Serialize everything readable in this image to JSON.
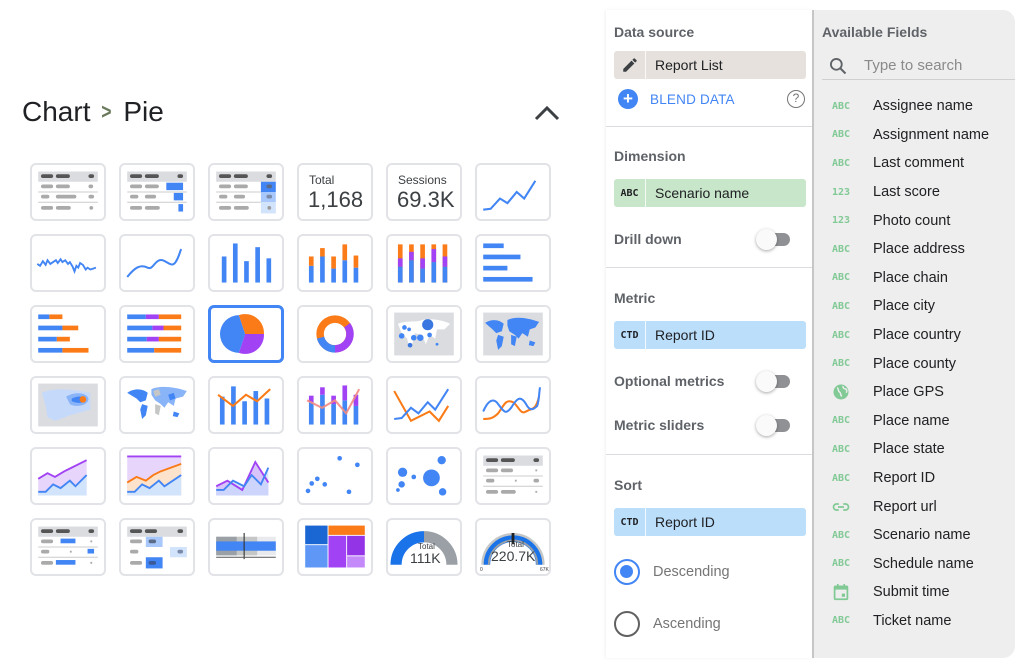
{
  "picker": {
    "breadcrumb": [
      "Chart",
      "Pie"
    ],
    "breadcrumb_separator": ">",
    "collapse_icon": "chevron-up-icon",
    "selected": "pie",
    "thumbnails": [
      {
        "id": "table"
      },
      {
        "id": "table-with-bars"
      },
      {
        "id": "table-heatmap"
      },
      {
        "id": "scorecard-total",
        "label": "Total",
        "value": "1,168"
      },
      {
        "id": "scorecard-sessions",
        "label": "Sessions",
        "value": "69.3K"
      },
      {
        "id": "time-series"
      },
      {
        "id": "sparkline"
      },
      {
        "id": "smoothed-line"
      },
      {
        "id": "column"
      },
      {
        "id": "stacked-column"
      },
      {
        "id": "100-stacked-column"
      },
      {
        "id": "bar"
      },
      {
        "id": "stacked-bar"
      },
      {
        "id": "100-stacked-bar"
      },
      {
        "id": "pie"
      },
      {
        "id": "donut"
      },
      {
        "id": "bubble-map"
      },
      {
        "id": "filled-map"
      },
      {
        "id": "heatmap-map"
      },
      {
        "id": "geo-chart"
      },
      {
        "id": "combo"
      },
      {
        "id": "stacked-combo"
      },
      {
        "id": "line"
      },
      {
        "id": "smoothed-line-2"
      },
      {
        "id": "area"
      },
      {
        "id": "stacked-area"
      },
      {
        "id": "100-stacked-area"
      },
      {
        "id": "scatter"
      },
      {
        "id": "bubble"
      },
      {
        "id": "pivot-table"
      },
      {
        "id": "pivot-table-bars"
      },
      {
        "id": "pivot-table-heatmap"
      },
      {
        "id": "bullet"
      },
      {
        "id": "treemap"
      },
      {
        "id": "gauge",
        "label": "Total",
        "value": "111K"
      },
      {
        "id": "gauge-with-target",
        "label": "Total",
        "value": "220.7K",
        "min": "0",
        "max": "67K"
      }
    ]
  },
  "colors": {
    "blue": "#4285f4",
    "orange": "#fa7b17",
    "purple": "#a142f4",
    "grid_border": "#e1e3e6",
    "dimension_chip": "#c8e6c9",
    "metric_chip": "#bbdefb",
    "source_chip": "#e6e1dd",
    "field_type_green": "#81c995"
  },
  "settings": {
    "data_source": {
      "title": "Data source",
      "value": "Report List",
      "icon": "pencil-icon",
      "blend_label": "BLEND DATA",
      "help_icon": "help-icon"
    },
    "dimension": {
      "title": "Dimension",
      "type": "ABC",
      "value": "Scenario name"
    },
    "drill_down": {
      "label": "Drill down",
      "on": false
    },
    "metric": {
      "title": "Metric",
      "type": "CTD",
      "value": "Report ID"
    },
    "optional_metrics": {
      "label": "Optional metrics",
      "on": false
    },
    "metric_sliders": {
      "label": "Metric sliders",
      "on": false
    },
    "sort": {
      "title": "Sort",
      "type": "CTD",
      "value": "Report ID",
      "options": [
        {
          "label": "Descending",
          "checked": true
        },
        {
          "label": "Ascending",
          "checked": false
        }
      ]
    }
  },
  "fields_panel": {
    "title": "Available Fields",
    "search_placeholder": "Type to search",
    "search_value": "",
    "fields": [
      {
        "type": "ABC",
        "label": "Assignee name"
      },
      {
        "type": "ABC",
        "label": "Assignment name"
      },
      {
        "type": "ABC",
        "label": "Last comment"
      },
      {
        "type": "123",
        "label": "Last score"
      },
      {
        "type": "123",
        "label": "Photo count"
      },
      {
        "type": "ABC",
        "label": "Place address"
      },
      {
        "type": "ABC",
        "label": "Place chain"
      },
      {
        "type": "ABC",
        "label": "Place city"
      },
      {
        "type": "ABC",
        "label": "Place country"
      },
      {
        "type": "ABC",
        "label": "Place county"
      },
      {
        "type": "globe-icon",
        "label": "Place GPS"
      },
      {
        "type": "ABC",
        "label": "Place name"
      },
      {
        "type": "ABC",
        "label": "Place state"
      },
      {
        "type": "ABC",
        "label": "Report ID"
      },
      {
        "type": "link-icon",
        "label": "Report url"
      },
      {
        "type": "ABC",
        "label": "Scenario name"
      },
      {
        "type": "ABC",
        "label": "Schedule name"
      },
      {
        "type": "calendar-icon",
        "label": "Submit time"
      },
      {
        "type": "ABC",
        "label": "Ticket name"
      }
    ]
  }
}
